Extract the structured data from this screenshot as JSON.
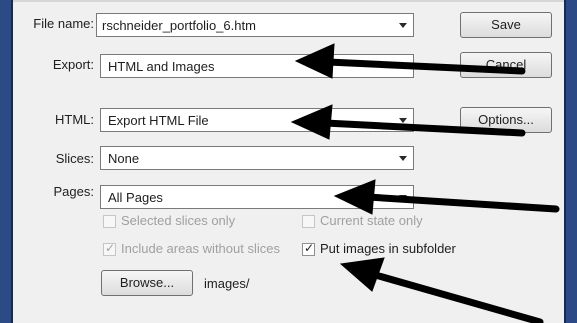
{
  "dialog": {
    "file_name": {
      "label": "File name:",
      "value": "rschneider_portfolio_6.htm"
    },
    "export": {
      "label": "Export:",
      "value": "HTML and Images"
    },
    "html": {
      "label": "HTML:",
      "value": "Export HTML File"
    },
    "slices": {
      "label": "Slices:",
      "value": "None"
    },
    "pages": {
      "label": "Pages:",
      "value": "All Pages"
    },
    "options": {
      "selected_slices_only": {
        "label": "Selected slices only",
        "checked": false,
        "enabled": false
      },
      "current_state_only": {
        "label": "Current state only",
        "checked": false,
        "enabled": false
      },
      "include_areas_without_slices": {
        "label": "Include areas without slices",
        "checked": true,
        "enabled": false
      },
      "put_images_in_subfolder": {
        "label": "Put images in subfolder",
        "checked": true,
        "enabled": true
      }
    },
    "buttons": {
      "save": "Save",
      "cancel": "Cancel",
      "options": "Options...",
      "browse": "Browse..."
    },
    "images_folder": "images/"
  },
  "annotation_color": "#000000",
  "window_border_color": "#2b4a86"
}
